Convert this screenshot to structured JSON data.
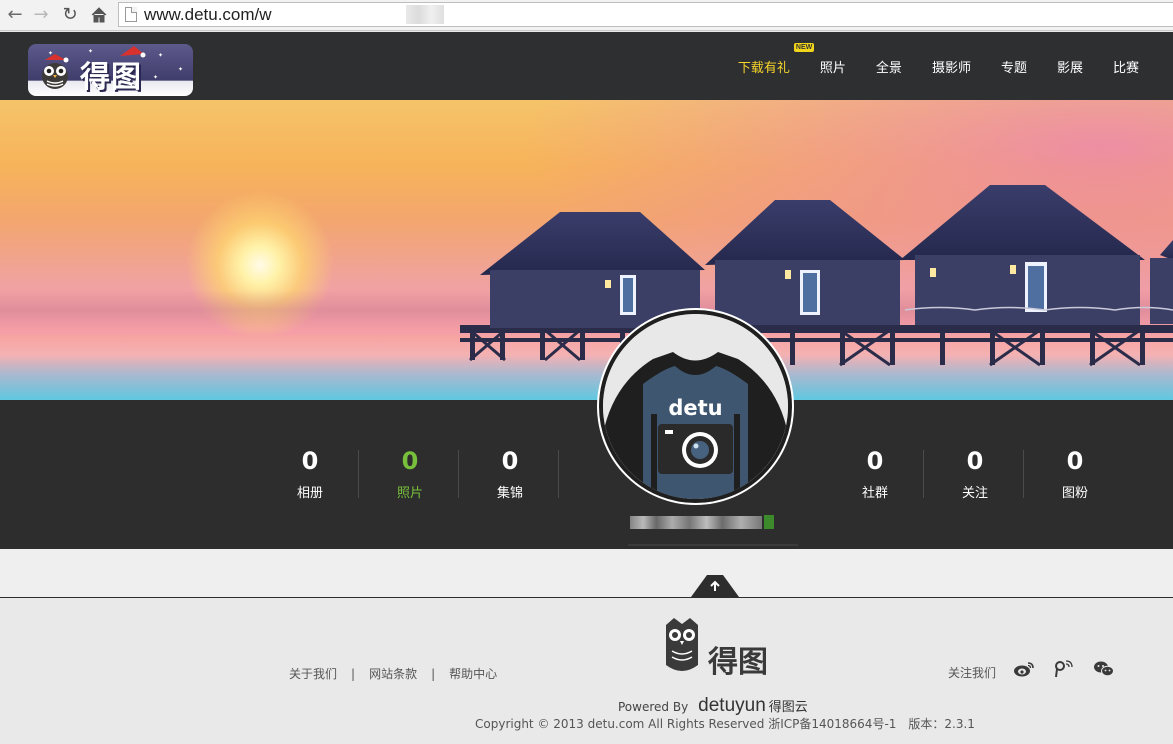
{
  "browser": {
    "url": "www.detu.com/w",
    "icons": [
      "back-arrow-icon",
      "forward-arrow-icon",
      "reload-icon",
      "home-icon",
      "page-icon"
    ]
  },
  "header": {
    "logo_text": "得图",
    "nav": [
      {
        "label": "下载有礼",
        "badge": "NEW",
        "active": true
      },
      {
        "label": "照片"
      },
      {
        "label": "全景"
      },
      {
        "label": "摄影师"
      },
      {
        "label": "专题"
      },
      {
        "label": "影展"
      },
      {
        "label": "比赛"
      }
    ],
    "colors": {
      "bar": "#2e2f31",
      "active": "#f5d42b"
    }
  },
  "profile": {
    "avatar_text": "detu",
    "stats_left": [
      {
        "value": "0",
        "label": "相册"
      },
      {
        "value": "0",
        "label": "照片",
        "highlight": true
      },
      {
        "value": "0",
        "label": "集锦"
      }
    ],
    "stats_right": [
      {
        "value": "0",
        "label": "社群"
      },
      {
        "value": "0",
        "label": "关注"
      },
      {
        "value": "0",
        "label": "图粉"
      }
    ],
    "highlight_color": "#78c03b"
  },
  "footer": {
    "links": [
      "关于我们",
      "网站条款",
      "帮助中心"
    ],
    "logo_text": "得图",
    "powered_prefix": "Powered By",
    "powered_brand": "detuyun",
    "powered_brand_cn": "得图云",
    "copyright": "Copyright © 2013 detu.com All Rights Reserved 浙ICP备14018664号-1　版本：2.3.1",
    "follow_label": "关注我们",
    "social_icons": [
      "weibo-icon",
      "tencent-weibo-icon",
      "wechat-icon"
    ]
  }
}
